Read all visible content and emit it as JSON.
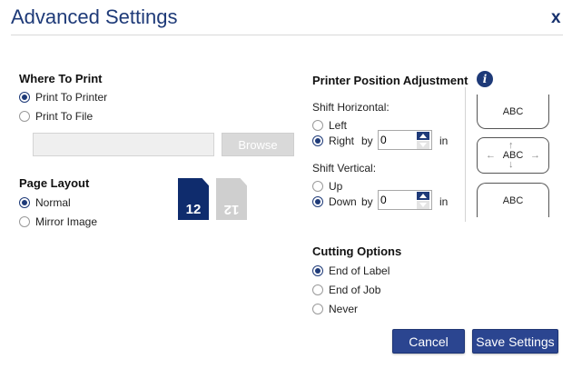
{
  "dialog": {
    "title": "Advanced Settings",
    "close_label": "x"
  },
  "where_to_print": {
    "heading": "Where To Print",
    "options": [
      "Print To Printer",
      "Print To File"
    ],
    "selected": "Print To Printer",
    "file_path": {
      "value": "",
      "placeholder": ""
    },
    "browse_label": "Browse"
  },
  "page_layout": {
    "heading": "Page Layout",
    "options": [
      "Normal",
      "Mirror Image"
    ],
    "selected": "Normal",
    "preview_number": "12"
  },
  "printer_position": {
    "heading": "Printer Position Adjustment",
    "info_icon": "i",
    "shift_horizontal": {
      "label": "Shift Horizontal:",
      "options": [
        "Left",
        "Right"
      ],
      "selected": "Right",
      "by_label": "by",
      "value": "0",
      "unit": "in"
    },
    "shift_vertical": {
      "label": "Shift Vertical:",
      "options": [
        "Up",
        "Down"
      ],
      "selected": "Down",
      "by_label": "by",
      "value": "0",
      "unit": "in"
    },
    "preview": {
      "top": "ABC",
      "middle": "ABC",
      "bottom": "ABC"
    }
  },
  "cutting_options": {
    "heading": "Cutting Options",
    "options": [
      "End of Label",
      "End of Job",
      "Never"
    ],
    "selected": "End of Label"
  },
  "footer": {
    "cancel_label": "Cancel",
    "save_label": "Save Settings"
  },
  "colors": {
    "accent": "#1e3a78",
    "button": "#2b4590",
    "disabled": "#d9d9d9"
  }
}
